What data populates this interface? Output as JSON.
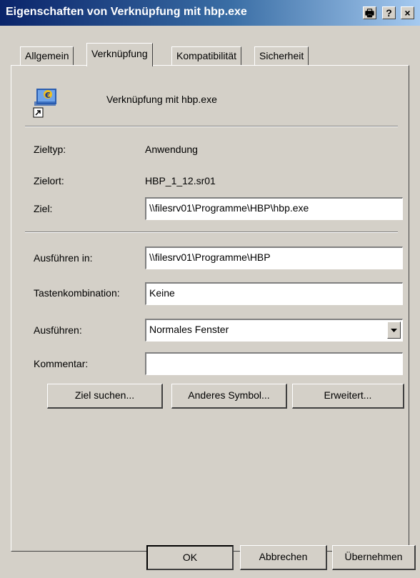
{
  "window": {
    "title": "Eigenschaften von Verknüpfung mit hbp.exe",
    "print_symbol": "🖶",
    "help_symbol": "?",
    "close_symbol": "×"
  },
  "tabs": [
    {
      "label": "Allgemein"
    },
    {
      "label": "Verknüpfung"
    },
    {
      "label": "Kompatibilität"
    },
    {
      "label": "Sicherheit"
    }
  ],
  "shortcut": {
    "name": "Verknüpfung mit hbp.exe"
  },
  "fields": {
    "zieltyp_label": "Zieltyp:",
    "zieltyp_value": "Anwendung",
    "zielort_label": "Zielort:",
    "zielort_value": "HBP_1_12.sr01",
    "ziel_label": "Ziel:",
    "ziel_value": "\\\\filesrv01\\Programme\\HBP\\hbp.exe",
    "ausfuehren_in_label": "Ausführen in:",
    "ausfuehren_in_value": "\\\\filesrv01\\Programme\\HBP",
    "tastenkombination_label": "Tastenkombination:",
    "tastenkombination_value": "Keine",
    "ausfuehren_label": "Ausführen:",
    "ausfuehren_value": "Normales Fenster",
    "kommentar_label": "Kommentar:",
    "kommentar_value": ""
  },
  "buttons": {
    "ziel_suchen": "Ziel suchen...",
    "anderes_symbol": "Anderes Symbol...",
    "erweitert": "Erweitert...",
    "ok": "OK",
    "abbrechen": "Abbrechen",
    "uebernehmen": "Übernehmen"
  }
}
